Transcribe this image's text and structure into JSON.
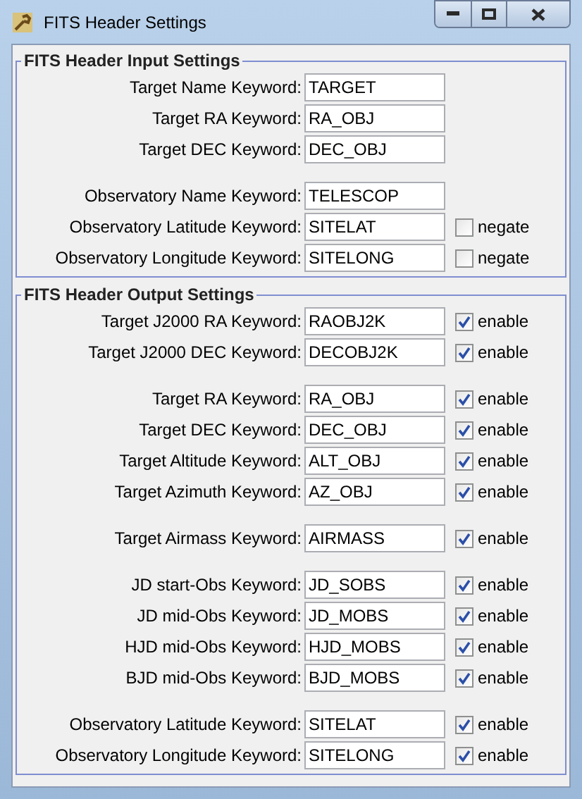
{
  "window": {
    "title": "FITS Header Settings"
  },
  "groups": [
    {
      "title": "FITS Header Input Settings",
      "blocks": [
        [
          {
            "label": "Target Name Keyword:",
            "value": "TARGET"
          },
          {
            "label": "Target RA Keyword:",
            "value": "RA_OBJ"
          },
          {
            "label": "Target DEC Keyword:",
            "value": "DEC_OBJ"
          }
        ],
        [
          {
            "label": "Observatory Name Keyword:",
            "value": "TELESCOP"
          },
          {
            "label": "Observatory Latitude Keyword:",
            "value": "SITELAT",
            "option": {
              "label": "negate",
              "checked": false
            }
          },
          {
            "label": "Observatory Longitude Keyword:",
            "value": "SITELONG",
            "option": {
              "label": "negate",
              "checked": false
            }
          }
        ]
      ]
    },
    {
      "title": "FITS Header Output Settings",
      "blocks": [
        [
          {
            "label": "Target J2000 RA Keyword:",
            "value": "RAOBJ2K",
            "option": {
              "label": "enable",
              "checked": true
            }
          },
          {
            "label": "Target J2000 DEC Keyword:",
            "value": "DECOBJ2K",
            "option": {
              "label": "enable",
              "checked": true
            }
          }
        ],
        [
          {
            "label": "Target RA Keyword:",
            "value": "RA_OBJ",
            "option": {
              "label": "enable",
              "checked": true
            }
          },
          {
            "label": "Target DEC Keyword:",
            "value": "DEC_OBJ",
            "option": {
              "label": "enable",
              "checked": true
            }
          },
          {
            "label": "Target Altitude Keyword:",
            "value": "ALT_OBJ",
            "option": {
              "label": "enable",
              "checked": true
            }
          },
          {
            "label": "Target Azimuth Keyword:",
            "value": "AZ_OBJ",
            "option": {
              "label": "enable",
              "checked": true
            }
          }
        ],
        [
          {
            "label": "Target Airmass Keyword:",
            "value": "AIRMASS",
            "option": {
              "label": "enable",
              "checked": true
            }
          }
        ],
        [
          {
            "label": "JD start-Obs Keyword:",
            "value": "JD_SOBS",
            "option": {
              "label": "enable",
              "checked": true
            }
          },
          {
            "label": "JD mid-Obs Keyword:",
            "value": "JD_MOBS",
            "option": {
              "label": "enable",
              "checked": true
            }
          },
          {
            "label": "HJD mid-Obs Keyword:",
            "value": "HJD_MOBS",
            "option": {
              "label": "enable",
              "checked": true
            }
          },
          {
            "label": "BJD mid-Obs Keyword:",
            "value": "BJD_MOBS",
            "option": {
              "label": "enable",
              "checked": true
            }
          }
        ],
        [
          {
            "label": "Observatory Latitude Keyword:",
            "value": "SITELAT",
            "option": {
              "label": "enable",
              "checked": true
            }
          },
          {
            "label": "Observatory Longitude Keyword:",
            "value": "SITELONG",
            "option": {
              "label": "enable",
              "checked": true
            }
          }
        ]
      ]
    }
  ]
}
